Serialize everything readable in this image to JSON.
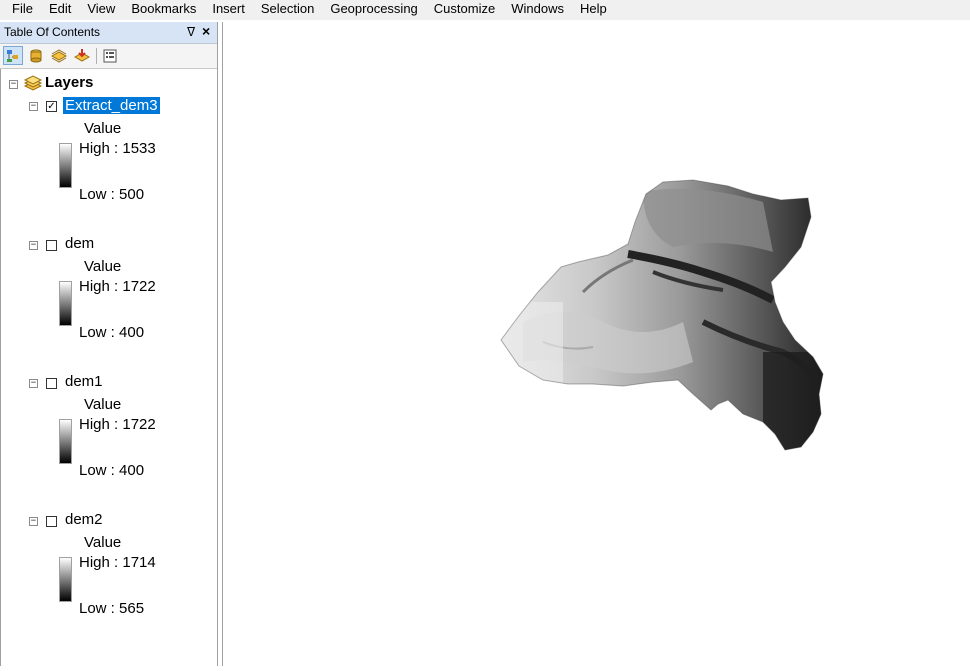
{
  "menu": [
    "File",
    "Edit",
    "View",
    "Bookmarks",
    "Insert",
    "Selection",
    "Geoprocessing",
    "Customize",
    "Windows",
    "Help"
  ],
  "toc": {
    "title": "Table Of Contents",
    "pin_glyph": "ᐁ",
    "close_glyph": "×",
    "root_label": "Layers",
    "layers": [
      {
        "name": "Extract_dem3",
        "checked": true,
        "selected": true,
        "field": "Value",
        "high": "High : 1533",
        "low": "Low : 500"
      },
      {
        "name": "dem",
        "checked": false,
        "selected": false,
        "field": "Value",
        "high": "High : 1722",
        "low": "Low : 400"
      },
      {
        "name": "dem1",
        "checked": false,
        "selected": false,
        "field": "Value",
        "high": "High : 1722",
        "low": "Low : 400"
      },
      {
        "name": "dem2",
        "checked": false,
        "selected": false,
        "field": "Value",
        "high": "High : 1714",
        "low": "Low : 565"
      }
    ]
  },
  "icons": {
    "toolbar": [
      "list-by-drawing-order-icon",
      "list-by-source-icon",
      "list-by-visibility-icon",
      "list-by-selection-icon",
      "options-icon"
    ]
  },
  "colors": {
    "selection": "#0078d7",
    "title_bar": "#d6e4f5",
    "ramp_high": "#ffffff",
    "ramp_low": "#000000"
  }
}
